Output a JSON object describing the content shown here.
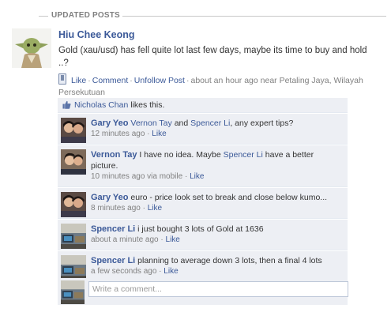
{
  "section": {
    "title": "UPDATED POSTS"
  },
  "post": {
    "author": "Hiu Chee Keong",
    "text": "Gold (xau/usd) has fell quite lot last few days, maybe its time to buy and hold ..?",
    "actions": {
      "like": "Like",
      "comment": "Comment",
      "unfollow": "Unfollow Post",
      "time_location": "about an hour ago near Petaling Jaya, Wilayah Persekutuan"
    },
    "likes": {
      "name": "Nicholas Chan",
      "suffix": "likes this."
    }
  },
  "comments": [
    {
      "author": "Gary Yeo",
      "segments": [
        {
          "type": "link",
          "text": "Vernon Tay"
        },
        {
          "type": "text",
          "text": " and "
        },
        {
          "type": "link",
          "text": "Spencer Li"
        },
        {
          "type": "text",
          "text": ", any expert tips?"
        }
      ],
      "time": "12 minutes ago",
      "like": "Like",
      "avatar": "couple"
    },
    {
      "author": "Vernon Tay",
      "segments": [
        {
          "type": "text",
          "text": "I have no idea. Maybe "
        },
        {
          "type": "link",
          "text": "Spencer Li"
        },
        {
          "type": "text",
          "text": " have a better picture."
        }
      ],
      "time": "10 minutes ago via mobile",
      "like": "Like",
      "avatar": "couple2"
    },
    {
      "author": "Gary Yeo",
      "segments": [
        {
          "type": "text",
          "text": "euro - price look set to break and close below kumo..."
        }
      ],
      "time": "8 minutes ago",
      "like": "Like",
      "avatar": "couple"
    },
    {
      "author": "Spencer Li",
      "segments": [
        {
          "type": "text",
          "text": "i just bought 3 lots of Gold at 1636"
        }
      ],
      "time": "about a minute ago",
      "like": "Like",
      "avatar": "room"
    },
    {
      "author": "Spencer Li",
      "segments": [
        {
          "type": "text",
          "text": "planning to average down 3 lots, then a final 4 lots"
        }
      ],
      "time": "a few seconds ago",
      "like": "Like",
      "avatar": "room"
    }
  ],
  "write_comment": {
    "placeholder": "Write a comment..."
  },
  "colors": {
    "link": "#3b5998",
    "comment_bg": "#edeff4",
    "meta": "#808080"
  }
}
